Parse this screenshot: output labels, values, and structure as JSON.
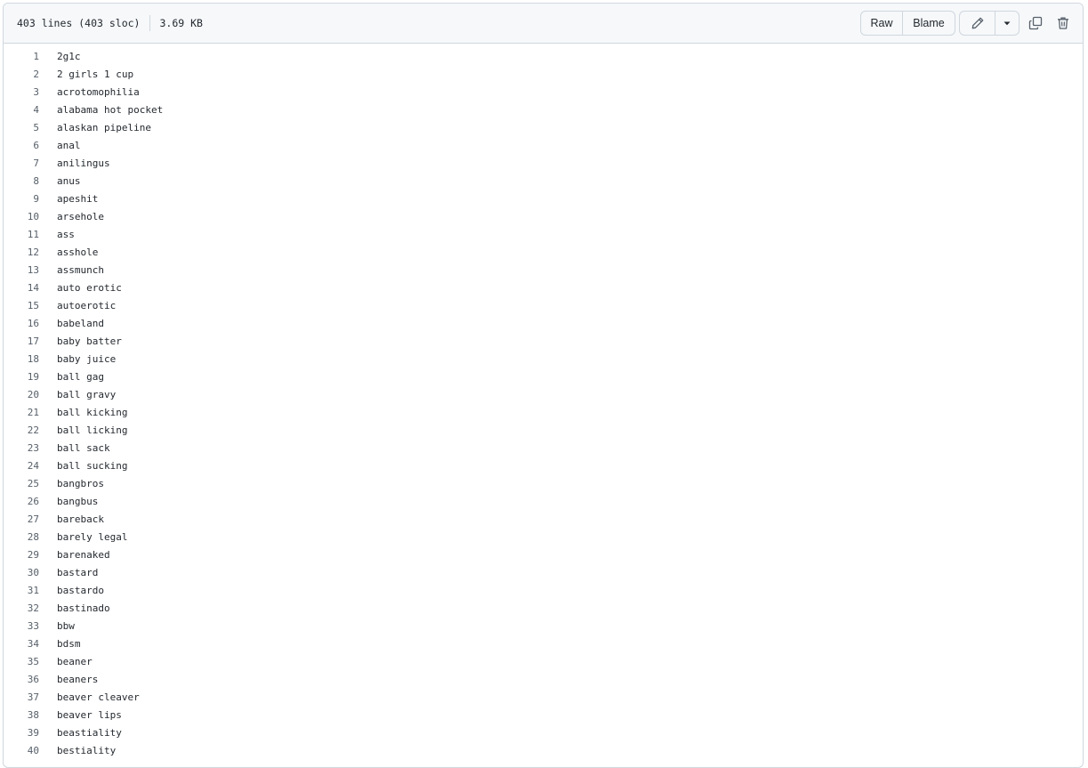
{
  "file_info": {
    "lines": "403 lines (403 sloc)",
    "size": "3.69 KB"
  },
  "actions": {
    "raw_label": "Raw",
    "blame_label": "Blame",
    "edit_icon": "pencil-icon",
    "more_icon": "caret-down-icon",
    "copy_icon": "copy-icon",
    "delete_icon": "trash-icon"
  },
  "lines": [
    {
      "num": "1",
      "text": "2g1c"
    },
    {
      "num": "2",
      "text": "2 girls 1 cup"
    },
    {
      "num": "3",
      "text": "acrotomophilia"
    },
    {
      "num": "4",
      "text": "alabama hot pocket"
    },
    {
      "num": "5",
      "text": "alaskan pipeline"
    },
    {
      "num": "6",
      "text": "anal"
    },
    {
      "num": "7",
      "text": "anilingus"
    },
    {
      "num": "8",
      "text": "anus"
    },
    {
      "num": "9",
      "text": "apeshit"
    },
    {
      "num": "10",
      "text": "arsehole"
    },
    {
      "num": "11",
      "text": "ass"
    },
    {
      "num": "12",
      "text": "asshole"
    },
    {
      "num": "13",
      "text": "assmunch"
    },
    {
      "num": "14",
      "text": "auto erotic"
    },
    {
      "num": "15",
      "text": "autoerotic"
    },
    {
      "num": "16",
      "text": "babeland"
    },
    {
      "num": "17",
      "text": "baby batter"
    },
    {
      "num": "18",
      "text": "baby juice"
    },
    {
      "num": "19",
      "text": "ball gag"
    },
    {
      "num": "20",
      "text": "ball gravy"
    },
    {
      "num": "21",
      "text": "ball kicking"
    },
    {
      "num": "22",
      "text": "ball licking"
    },
    {
      "num": "23",
      "text": "ball sack"
    },
    {
      "num": "24",
      "text": "ball sucking"
    },
    {
      "num": "25",
      "text": "bangbros"
    },
    {
      "num": "26",
      "text": "bangbus"
    },
    {
      "num": "27",
      "text": "bareback"
    },
    {
      "num": "28",
      "text": "barely legal"
    },
    {
      "num": "29",
      "text": "barenaked"
    },
    {
      "num": "30",
      "text": "bastard"
    },
    {
      "num": "31",
      "text": "bastardo"
    },
    {
      "num": "32",
      "text": "bastinado"
    },
    {
      "num": "33",
      "text": "bbw"
    },
    {
      "num": "34",
      "text": "bdsm"
    },
    {
      "num": "35",
      "text": "beaner"
    },
    {
      "num": "36",
      "text": "beaners"
    },
    {
      "num": "37",
      "text": "beaver cleaver"
    },
    {
      "num": "38",
      "text": "beaver lips"
    },
    {
      "num": "39",
      "text": "beastiality"
    },
    {
      "num": "40",
      "text": "bestiality"
    }
  ]
}
